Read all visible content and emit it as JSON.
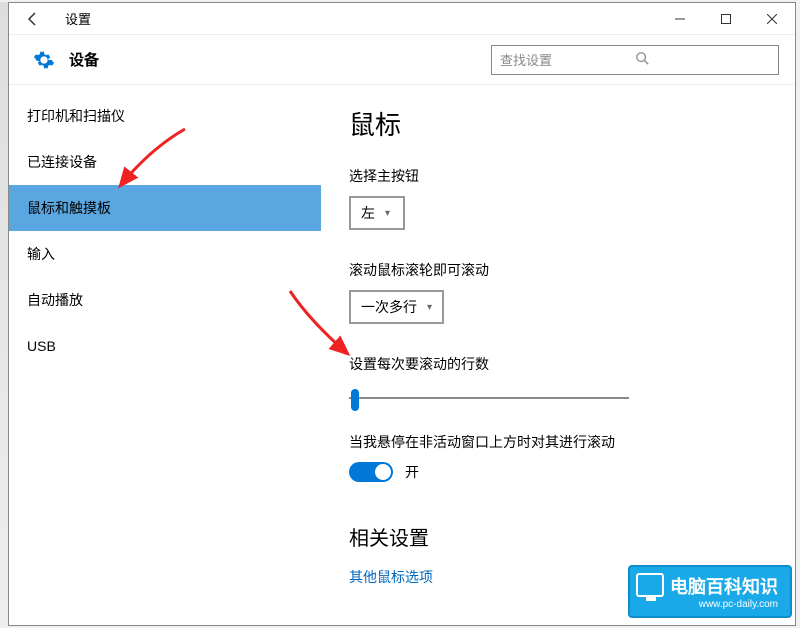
{
  "titlebar": {
    "title": "设置"
  },
  "header": {
    "title": "设备",
    "search_placeholder": "查找设置"
  },
  "sidebar": {
    "items": [
      {
        "label": "打印机和扫描仪"
      },
      {
        "label": "已连接设备"
      },
      {
        "label": "鼠标和触摸板"
      },
      {
        "label": "输入"
      },
      {
        "label": "自动播放"
      },
      {
        "label": "USB"
      }
    ],
    "selected_index": 2
  },
  "main": {
    "heading": "鼠标",
    "primary_button_label": "选择主按钮",
    "primary_button_value": "左",
    "scroll_mode_label": "滚动鼠标滚轮即可滚动",
    "scroll_mode_value": "一次多行",
    "lines_label": "设置每次要滚动的行数",
    "hover_label": "当我悬停在非活动窗口上方时对其进行滚动",
    "hover_toggle_state": "开",
    "related_heading": "相关设置",
    "related_link": "其他鼠标选项"
  },
  "watermark": {
    "brand": "电脑百科知识",
    "url": "www.pc-daily.com"
  }
}
